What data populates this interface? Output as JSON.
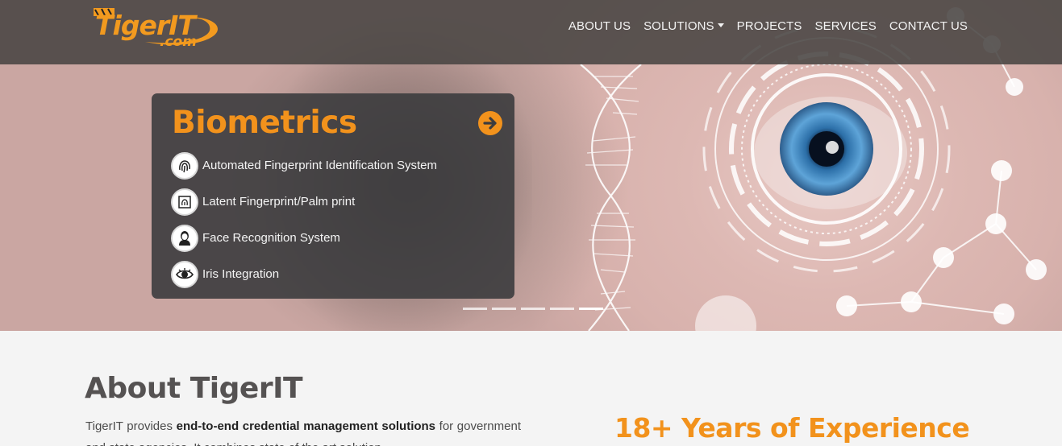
{
  "brand": {
    "logo_text": "TigerIT",
    "logo_sub": ".com"
  },
  "nav": {
    "items": [
      {
        "label": "ABOUT US"
      },
      {
        "label": "SOLUTIONS",
        "dropdown": true
      },
      {
        "label": "PROJECTS"
      },
      {
        "label": "SERVICES"
      },
      {
        "label": "CONTACT US"
      }
    ]
  },
  "hero": {
    "card_title": "Biometrics",
    "items": [
      {
        "label": "Automated Fingerprint Identification System",
        "icon": "fingerprint-icon"
      },
      {
        "label": "Latent Fingerprint/Palm print",
        "icon": "palm-print-icon"
      },
      {
        "label": "Face Recognition System",
        "icon": "face-icon"
      },
      {
        "label": "Iris Integration",
        "icon": "eye-icon"
      }
    ],
    "slides": 5,
    "active_slide": 5
  },
  "about": {
    "title": "About TigerIT",
    "text_prefix": "TigerIT provides ",
    "text_bold": "end-to-end credential management solutions",
    "text_suffix": " for government and state agencies. It combines state of the art solution"
  },
  "experience": {
    "title": "18+ Years of Experience"
  },
  "colors": {
    "accent": "#f2921c",
    "nav_bg": "#484442",
    "card_bg": "#3c3c3e"
  }
}
